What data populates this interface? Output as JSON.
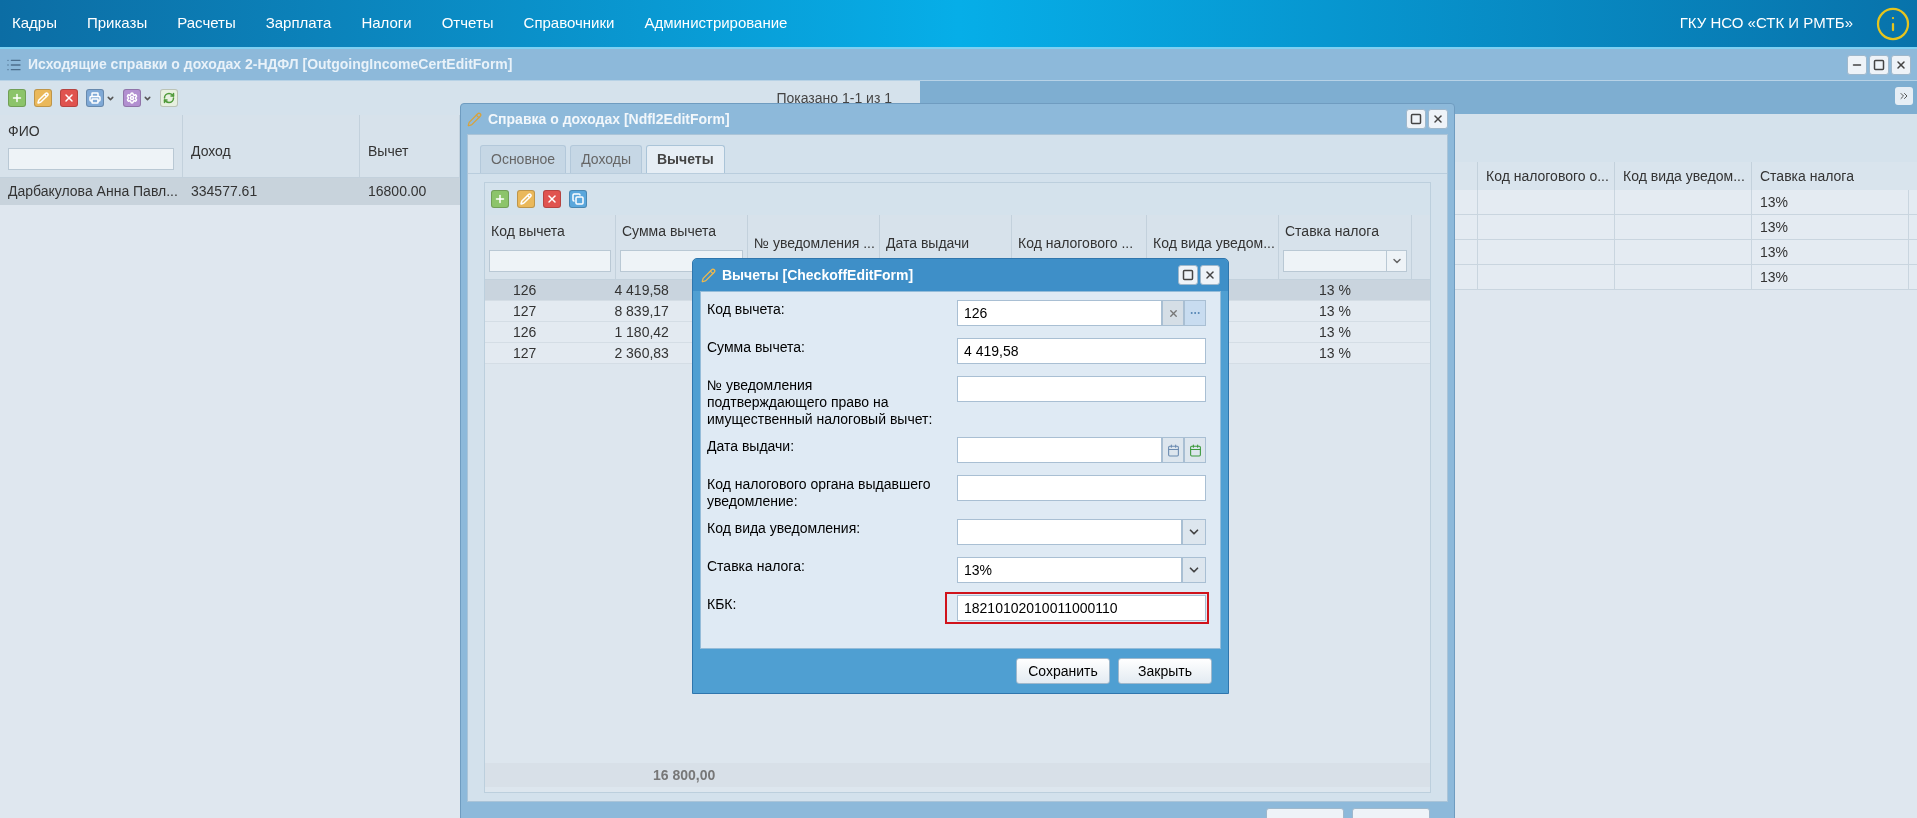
{
  "menu_bar": {
    "items": [
      "Кадры",
      "Приказы",
      "Расчеты",
      "Зарплата",
      "Налоги",
      "Отчеты",
      "Справочники",
      "Администрирование"
    ],
    "organization": "ГКУ НСО «СТК И РМТБ»"
  },
  "main_window": {
    "title": "Исходящие справки о доходах 2-НДФЛ [OutgoingIncomeCertEditForm]",
    "status": "Показано 1-1 из 1",
    "columns": [
      "ФИО",
      "Доход",
      "Вычет"
    ],
    "rows": [
      {
        "cells": [
          "Дарбакулова Анна Павл...",
          "334577.61",
          "16800.00"
        ],
        "selected": true
      }
    ]
  },
  "background_grid": {
    "columns": [
      "Код налогового о...",
      "Код вида уведом...",
      "Ставка налога"
    ],
    "rows": [
      {
        "rate": "13%"
      },
      {
        "rate": "13%"
      },
      {
        "rate": "13%"
      },
      {
        "rate": "13%"
      }
    ]
  },
  "income_window": {
    "title": "Справка о доходах [Ndfl2EditForm]",
    "tabs": [
      {
        "label": "Основное",
        "selected": false
      },
      {
        "label": "Доходы",
        "selected": false
      },
      {
        "label": "Вычеты",
        "selected": true
      }
    ],
    "columns": [
      "Код вычета",
      "Сумма вычета",
      "№ уведомления ...",
      "Дата выдачи",
      "Код налогового ...",
      "Код вида уведом...",
      "Ставка налога"
    ],
    "rows": [
      {
        "code": "126",
        "amount": "4 419,58",
        "rate": "13 %",
        "selected": true
      },
      {
        "code": "127",
        "amount": "8 839,17",
        "rate": "13 %",
        "selected": false
      },
      {
        "code": "126",
        "amount": "1 180,42",
        "rate": "13 %",
        "selected": false
      },
      {
        "code": "127",
        "amount": "2 360,83",
        "rate": "13 %",
        "selected": false
      }
    ],
    "total": "16 800,00"
  },
  "checkoff_dialog": {
    "title": "Вычеты [CheckoffEditForm]",
    "fields": [
      {
        "label": "Код вычета:",
        "value": "126",
        "kind": "lookup",
        "highlighted": false
      },
      {
        "label": "Сумма вычета:",
        "value": "4 419,58",
        "kind": "text",
        "highlighted": false
      },
      {
        "label": "№ уведомления подтверждающего право на имущественный налоговый вычет:",
        "kind": "text",
        "highlighted": false
      },
      {
        "label": "Дата выдачи:",
        "kind": "date",
        "highlighted": false
      },
      {
        "label": "Код налогового органа выдавшего уведомление:",
        "kind": "text",
        "highlighted": false
      },
      {
        "label": "Код вида уведомления:",
        "kind": "select",
        "highlighted": false
      },
      {
        "label": "Ставка налога:",
        "value": "13%",
        "kind": "select",
        "highlighted": false
      },
      {
        "label": "КБК:",
        "value": "18210102010011000110",
        "kind": "text",
        "highlighted": true
      }
    ],
    "buttons": [
      "Сохранить",
      "Закрыть"
    ]
  }
}
